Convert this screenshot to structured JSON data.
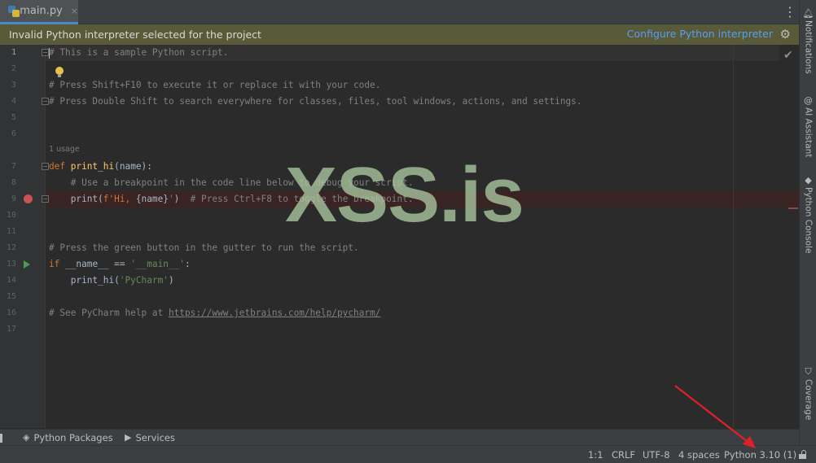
{
  "tab": {
    "label": "main.py",
    "close": "×"
  },
  "toolbar_menu_icon": "kebab-vertical-icon",
  "banner": {
    "message": "Invalid Python interpreter selected for the project",
    "action": "Configure Python interpreter"
  },
  "editor": {
    "line_numbers": [
      "1",
      "2",
      "3",
      "4",
      "5",
      "6",
      "7",
      "8",
      "9",
      "10",
      "11",
      "12",
      "13",
      "14",
      "15",
      "16",
      "17"
    ],
    "usage_hint": "1 usage",
    "lines": {
      "l1": "# This is a sample Python script.",
      "l3": "# Press Shift+F10 to execute it or replace it with your code.",
      "l4": "# Press Double Shift to search everywhere for classes, files, tool windows, actions, and settings.",
      "l7_kw": "def ",
      "l7_fn": "print_hi",
      "l7_rest": "(name):",
      "l8": "    # Use a breakpoint in the code line below to debug your script.",
      "l9_a": "    print(",
      "l9_b": "f'Hi, ",
      "l9_c": "{name}",
      "l9_d": "'",
      "l9_e": ")",
      "l9_cm": "  # Press Ctrl+F8 to toggle the breakpoint.",
      "l12": "# Press the green button in the gutter to run the script.",
      "l13_kw": "if ",
      "l13_a": "__name__ == ",
      "l13_st": "'__main__'",
      "l13_b": ":",
      "l14_a": "    print_hi(",
      "l14_st": "'PyCharm'",
      "l14_b": ")",
      "l16_cm": "# See PyCharm help at ",
      "l16_url": "https://www.jetbrains.com/help/pycharm/"
    }
  },
  "watermark": "XSS.is",
  "right_tools": [
    {
      "label": "Notifications",
      "icon": "bell-icon"
    },
    {
      "label": "AI Assistant",
      "icon": "ai-spiral-icon"
    },
    {
      "label": "Python Console",
      "icon": "python-icon"
    },
    {
      "label": "Coverage",
      "icon": "shield-icon"
    }
  ],
  "bottom_tools": [
    {
      "label": "Python Packages",
      "icon": "layers-icon"
    },
    {
      "label": "Services",
      "icon": "services-icon"
    }
  ],
  "status": {
    "position": "1:1",
    "line_separator": "CRLF",
    "encoding": "UTF-8",
    "indent": "4 spaces",
    "interpreter": "Python 3.10 (1)"
  },
  "colors": {
    "banner_bg": "#595a38",
    "link": "#589df6",
    "breakpoint": "#c75450",
    "annotation_arrow": "#e0202a"
  }
}
